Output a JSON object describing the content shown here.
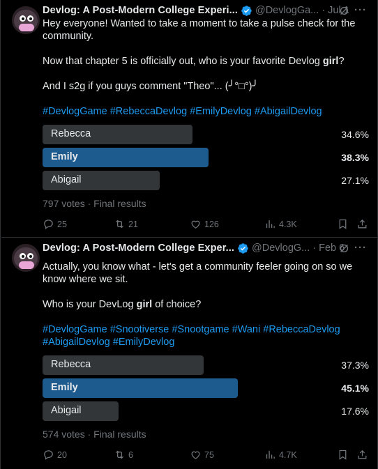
{
  "tweets": [
    {
      "author": "Devlog: A Post-Modern College Experi...",
      "handle": "@DevlogGa...",
      "date": "Jul 1",
      "more": "···",
      "text": [
        "Hey everyone! Wanted to take a moment to take a pulse check for the",
        "community.",
        "Now that chapter 5 is officially out, who is your favorite Devlog",
        "girl",
        "?",
        "And I s2g if you guys comment \"Theo\"... (╯°□°)╯"
      ],
      "hashtags": [
        "#DevlogGame",
        "#RebeccaDevlog",
        "#EmilyDevlog",
        "#AbigailDevlog"
      ],
      "poll": [
        {
          "label": "Rebecca",
          "pct": "34.6%",
          "value": 34.6,
          "winner": false
        },
        {
          "label": "Emily",
          "pct": "38.3%",
          "value": 38.3,
          "winner": true
        },
        {
          "label": "Abigail",
          "pct": "27.1%",
          "value": 27.1,
          "winner": false
        }
      ],
      "votes": "797 votes · Final results",
      "replies": "25",
      "retweets": "21",
      "likes": "126",
      "views": "4.3K"
    },
    {
      "author": "Devlog: A Post-Modern College Exper...",
      "handle": "@DevlogG...",
      "date": "Feb 6",
      "more": "···",
      "text": [
        "Actually, you know what - let's get a community feeler going on so we",
        "know where we sit.",
        "Who is your DevLog",
        "girl",
        "of choice?"
      ],
      "hashtags": [
        "#DevlogGame",
        "#Snootiverse",
        "#Snootgame",
        "#Wani",
        "#RebeccaDevlog",
        "#AbigailDevlog",
        "#EmilyDevlog"
      ],
      "poll": [
        {
          "label": "Rebecca",
          "pct": "37.3%",
          "value": 37.3,
          "winner": false
        },
        {
          "label": "Emily",
          "pct": "45.1%",
          "value": 45.1,
          "winner": true
        },
        {
          "label": "Abigail",
          "pct": "17.6%",
          "value": 17.6,
          "winner": false
        }
      ],
      "votes": "574 votes · Final results",
      "replies": "20",
      "retweets": "6",
      "likes": "75",
      "views": "4.7K"
    }
  ],
  "colors": {
    "link": "#1d9bf0",
    "winner_bar": "#1d5a8e",
    "bar": "#333639",
    "muted": "#71767b"
  },
  "icons": [
    "verified-badge-icon",
    "grok-icon",
    "reply-icon",
    "retweet-icon",
    "like-icon",
    "views-icon",
    "bookmark-icon",
    "share-icon"
  ]
}
